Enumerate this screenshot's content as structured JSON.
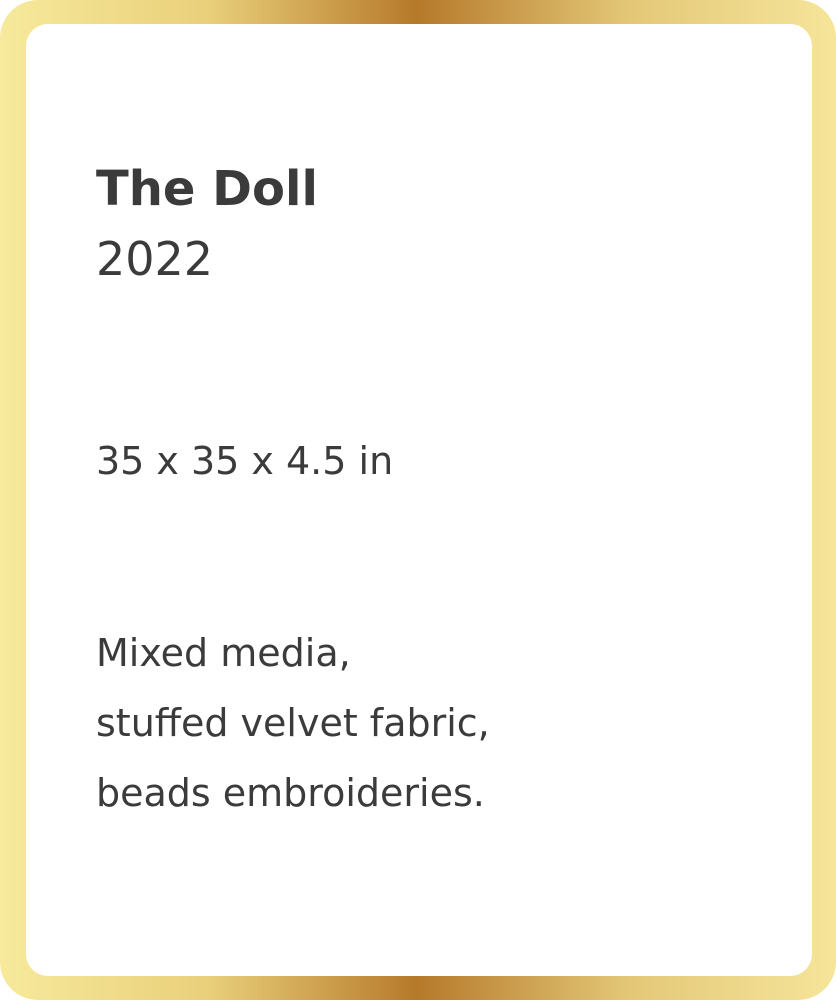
{
  "artwork": {
    "title": "The Doll",
    "year": "2022",
    "dimensions": "35 x 35 x 4.5 in",
    "materials": [
      "Mixed media,",
      "stuffed velvet fabric,",
      "beads embroideries."
    ]
  },
  "colors": {
    "text": "#3b3b3b",
    "frame_light": "#f7ea9c",
    "frame_dark": "#b6792a",
    "card": "#ffffff"
  }
}
